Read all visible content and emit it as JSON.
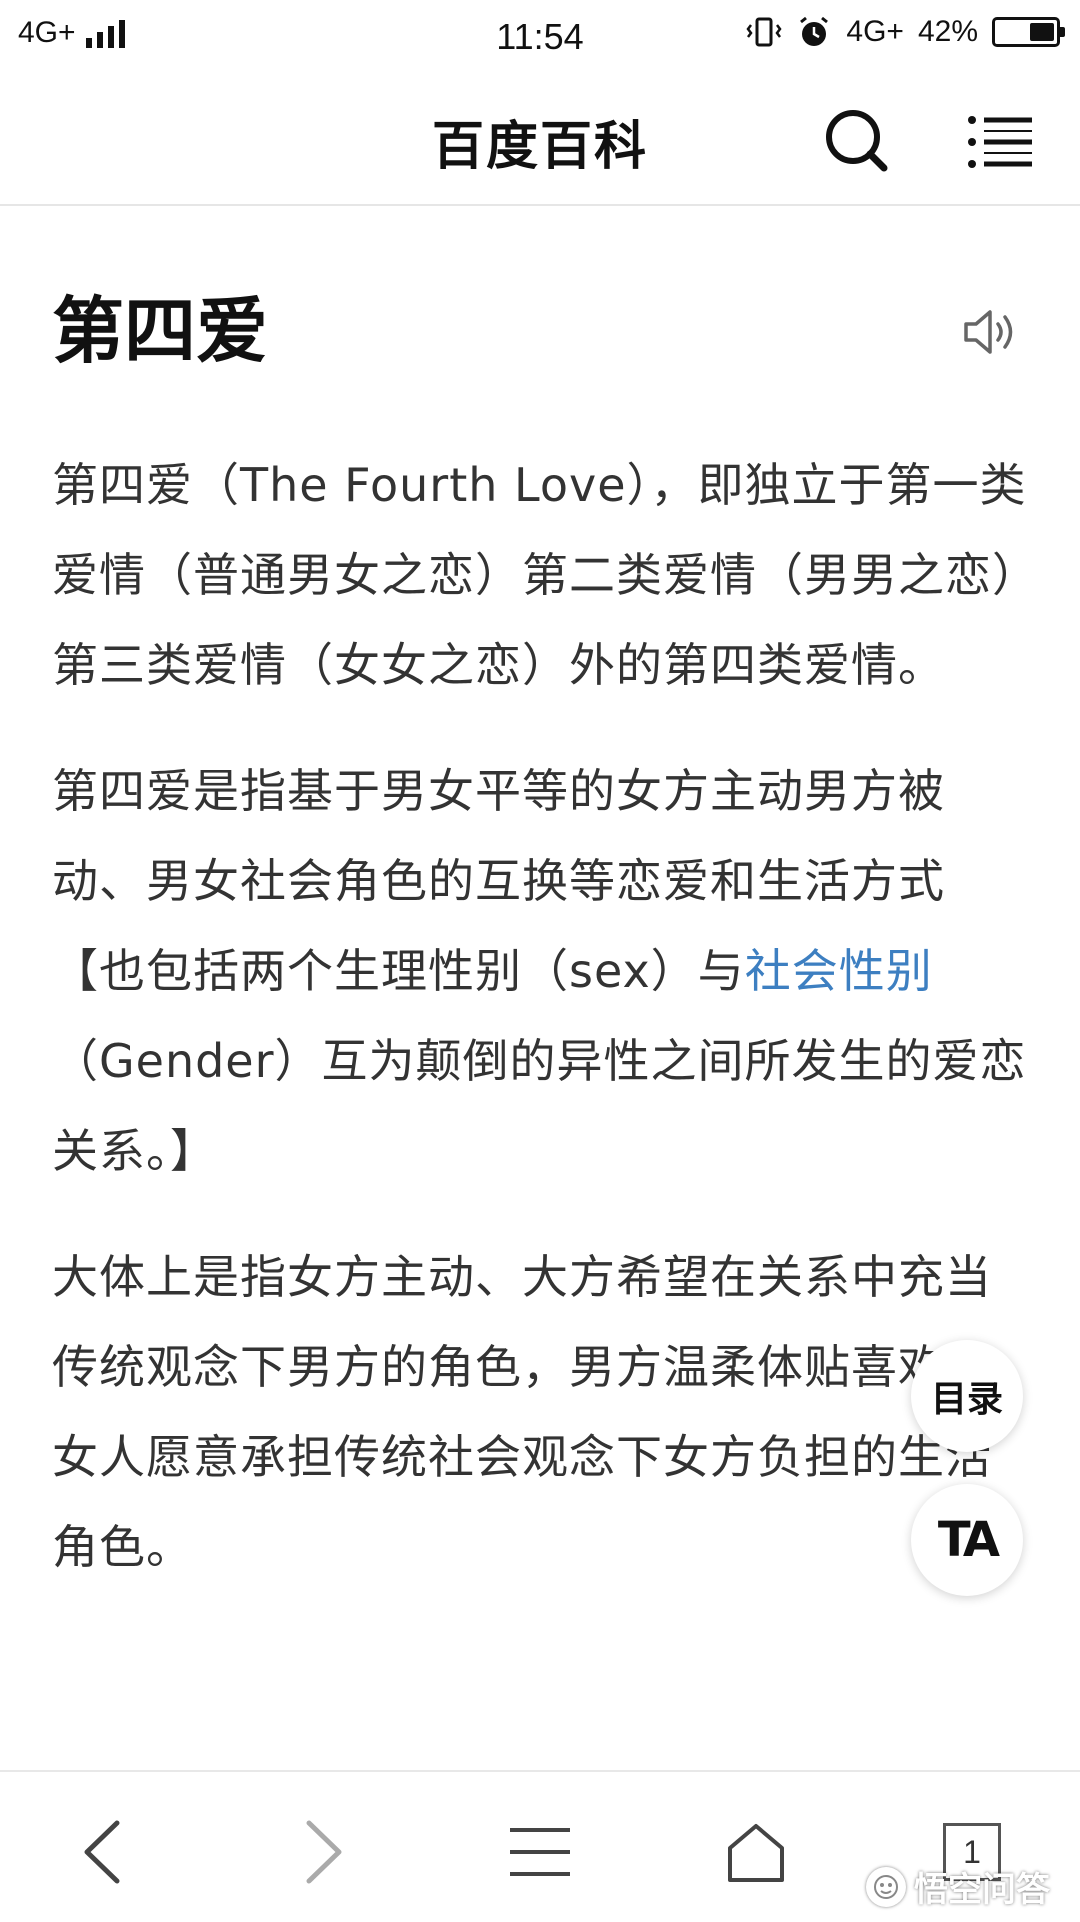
{
  "status_bar": {
    "network_left": "4G+",
    "time": "11:54",
    "network_right": "4G+",
    "battery": "42%",
    "battery_level": 0.42,
    "icons": [
      "signal-icon",
      "vibrate-icon",
      "alarm-icon",
      "battery-icon"
    ]
  },
  "header": {
    "title": "百度百科",
    "icons": [
      "search-icon",
      "menu-icon"
    ]
  },
  "article": {
    "title": "第四爱",
    "p1": "第四爱（The Fourth Love），即独立于第一类爱情（普通男女之恋）第二类爱情（男男之恋）第三类爱情（女女之恋）外的第四类爱情。",
    "p2_a": "第四爱是指基于男女平等的女方主动男方被动、男女社会角色的互换等恋爱和生活方式【也包括两个生理性别（sex）与",
    "p2_link": "社会性别",
    "p2_b": "（Gender）互为颠倒的异性之间所发生的爱恋关系。】",
    "p3": "大体上是指女方主动、大方希望在关系中充当传统观念下男方的角色，男方温柔体贴喜欢大女人愿意承担传统社会观念下女方负担的生活角色。",
    "link_color": "#3d7fc1"
  },
  "floating": {
    "toc_label": "目录",
    "ta_label": "TA"
  },
  "bottom_nav": {
    "tab_count": "1",
    "icons": [
      "back-icon",
      "forward-icon",
      "menu-icon",
      "home-icon",
      "tabs-icon"
    ]
  },
  "watermark": {
    "text": "悟空问答"
  }
}
